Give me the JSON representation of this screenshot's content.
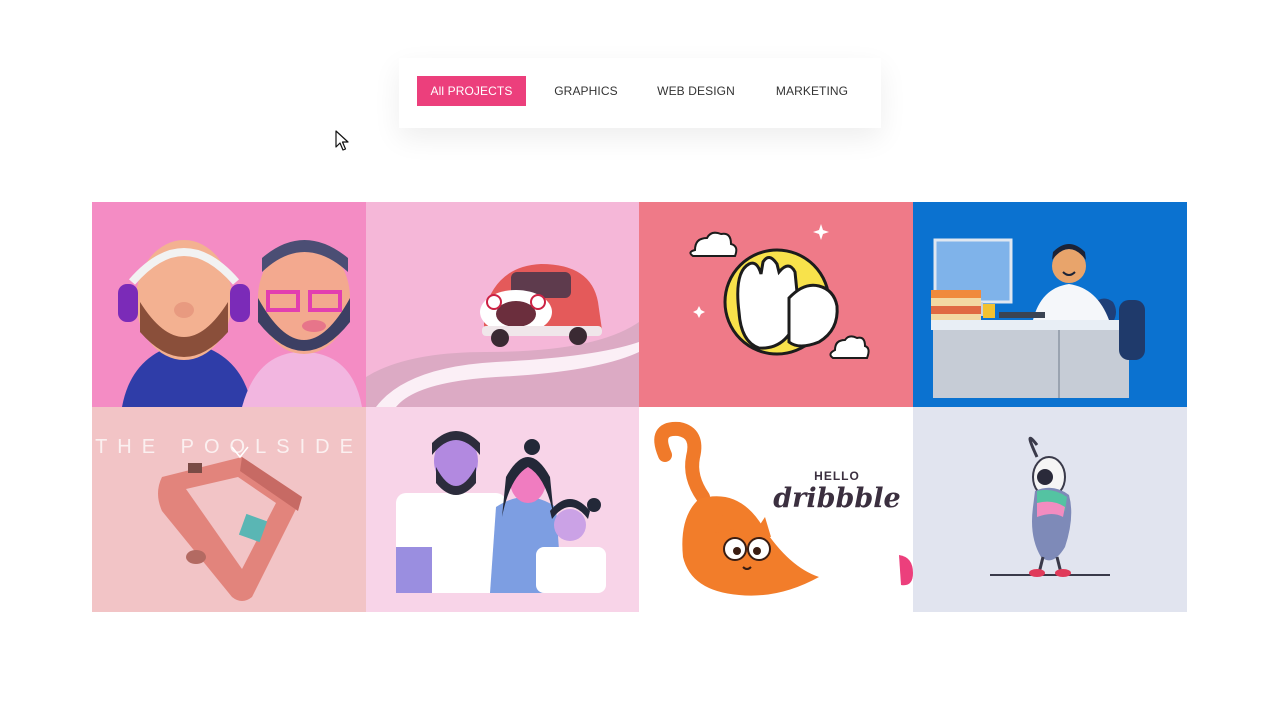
{
  "filters": {
    "items": [
      {
        "label": "All PROJECTS",
        "active": true
      },
      {
        "label": "GRAPHICS",
        "active": false
      },
      {
        "label": "WEB DESIGN",
        "active": false
      },
      {
        "label": "MARKETING",
        "active": false
      }
    ]
  },
  "portfolio": {
    "tiles": [
      {
        "name": "two-bearded-men-3d"
      },
      {
        "name": "red-car-on-road"
      },
      {
        "name": "clapping-hands-moon"
      },
      {
        "name": "man-at-office-desk"
      },
      {
        "name": "poolside-isometric",
        "text": "THE POOLSIDE"
      },
      {
        "name": "family-portrait"
      },
      {
        "name": "orange-cat-hello-dribbble",
        "text_hello": "HELLO",
        "text_brand": "dribbble"
      },
      {
        "name": "bird-character"
      }
    ]
  },
  "colors": {
    "accent": "#ec3f7c",
    "tile1_bg": "#f48cc4",
    "tile2_bg": "#f5b7d8",
    "tile3_bg": "#ef7a88",
    "tile4_bg": "#0b72d0",
    "tile5_bg": "#f2c4c6",
    "tile6_bg": "#f8d4e8",
    "tile7_bg": "#ffffff",
    "tile8_bg": "#e1e4ef"
  }
}
